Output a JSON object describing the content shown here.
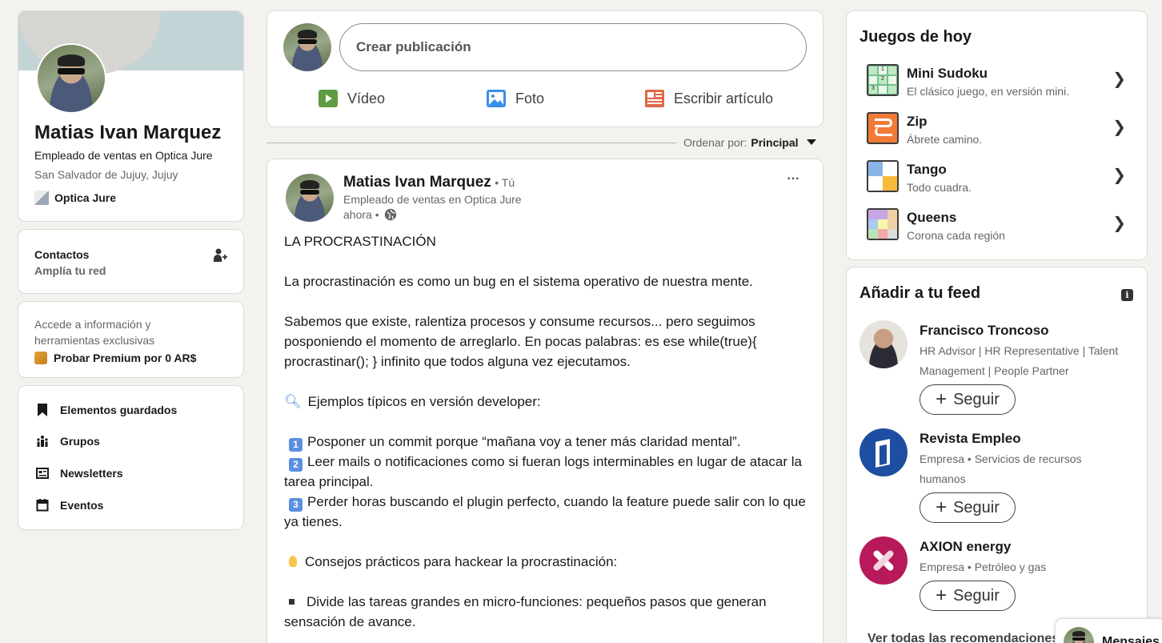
{
  "profile": {
    "name": "Matias Ivan Marquez",
    "headline": "Empleado de ventas en Optica Jure",
    "location": "San Salvador de Jujuy, Jujuy",
    "company": "Optica Jure"
  },
  "contacts": {
    "title": "Contactos",
    "subtitle": "Amplía tu red"
  },
  "premium": {
    "text": "Accede a información y herramientas exclusivas",
    "cta": "Probar Premium por 0 AR$"
  },
  "shortcuts": [
    {
      "label": "Elementos guardados",
      "icon": "bookmark-icon"
    },
    {
      "label": "Grupos",
      "icon": "groups-icon"
    },
    {
      "label": "Newsletters",
      "icon": "newsletter-icon"
    },
    {
      "label": "Eventos",
      "icon": "calendar-icon"
    }
  ],
  "composer": {
    "placeholder": "Crear publicación",
    "actions": [
      {
        "label": "Vídeo",
        "color": "#5f9b41"
      },
      {
        "label": "Foto",
        "color": "#378fe9"
      },
      {
        "label": "Escribir artículo",
        "color": "#e06847"
      }
    ]
  },
  "sort": {
    "label": "Ordenar por:",
    "value": "Principal"
  },
  "post": {
    "author": "Matias Ivan Marquez",
    "you": "• Tú",
    "headline": "Empleado de ventas en Optica Jure",
    "time": "ahora •",
    "more": "···",
    "title": "LA PROCRASTINACIÓN",
    "p1": "La procrastinación es como un bug en el sistema operativo de nuestra mente.",
    "p2": "Sabemos que existe, ralentiza procesos y consume recursos... pero seguimos posponiendo el momento de arreglarlo. En pocas palabras: es ese while(true){ procrastinar(); } infinito que todos alguna vez ejecutamos.",
    "examples_header": "Ejemplos típicos en versión developer:",
    "item1": "Posponer un commit porque “mañana voy a tener más claridad mental”.",
    "item2": "Leer mails o notificaciones como si fueran logs interminables en lugar de atacar la tarea principal.",
    "item3": "Perder horas buscando el plugin perfecto, cuando la feature puede salir con lo que ya tienes.",
    "tips_header": "Consejos prácticos para hackear la procrastinación:",
    "tip1": "Divide las tareas grandes en micro-funciones: pequeños pasos que generan sensación de avance."
  },
  "games": {
    "title": "Juegos de hoy",
    "items": [
      {
        "name": "Mini Sudoku",
        "desc": "El clásico juego, en versión mini."
      },
      {
        "name": "Zip",
        "desc": "Ábrete camino."
      },
      {
        "name": "Tango",
        "desc": "Todo cuadra."
      },
      {
        "name": "Queens",
        "desc": "Corona cada región"
      }
    ]
  },
  "feed": {
    "title": "Añadir a tu feed",
    "follow_label": "Seguir",
    "people": [
      {
        "name": "Francisco Troncoso",
        "desc": "HR Advisor | HR Representative | Talent Management | People Partner"
      },
      {
        "name": "Revista Empleo",
        "desc": "Empresa • Servicios de recursos humanos"
      },
      {
        "name": "AXION energy",
        "desc": "Empresa • Petróleo y gas"
      }
    ],
    "see_all": "Ver todas las recomendaciones"
  },
  "messaging": {
    "label": "Mensajes"
  }
}
